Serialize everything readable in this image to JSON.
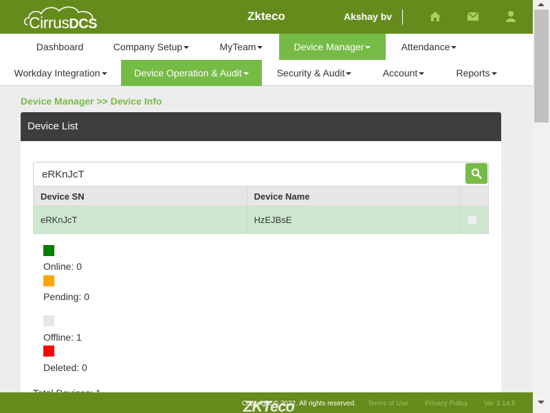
{
  "header": {
    "logo": {
      "prefix": "Cirrus",
      "suffix": "DCS"
    },
    "app_title": "Zkteco",
    "username": "Akshay bv",
    "icons": [
      "home-icon",
      "envelope-icon",
      "user-icon"
    ]
  },
  "nav": {
    "row1": [
      {
        "label": "Dashboard",
        "caret": false,
        "active": false
      },
      {
        "label": "Company Setup",
        "caret": true,
        "active": false
      },
      {
        "label": "MyTeam",
        "caret": true,
        "active": false
      },
      {
        "label": "Device Manager",
        "caret": true,
        "active": true
      },
      {
        "label": "Attendance",
        "caret": true,
        "active": false
      }
    ],
    "row2": [
      {
        "label": "Workday Integration",
        "caret": true,
        "active": false
      },
      {
        "label": "Device Operation & Audit",
        "caret": true,
        "active": true
      },
      {
        "label": "Security & Audit",
        "caret": true,
        "active": false
      },
      {
        "label": "Account",
        "caret": true,
        "active": false
      },
      {
        "label": "Reports",
        "caret": true,
        "active": false
      }
    ]
  },
  "breadcrumb": "Device Manager >> Device Info",
  "panel": {
    "title": "Device List",
    "search_value": "eRKnJcT",
    "table": {
      "columns": [
        "Device SN",
        "Device Name",
        ""
      ],
      "rows": [
        {
          "sn": "eRKnJcT",
          "name": "HzEJBsE",
          "checked": false
        }
      ]
    },
    "legend": [
      {
        "label": "Online: 0",
        "color": "#008000"
      },
      {
        "label": "Pending: 0",
        "color": "#ffa500"
      },
      {
        "label": "Offline: 1",
        "color": "#e6e6e6"
      },
      {
        "label": "Deleted: 0",
        "color": "#ff0000"
      }
    ],
    "total": "Total Devices: 1"
  },
  "footer": {
    "copyright": "Copyright © 2022. All rights reserved.",
    "watermark": "ZKTeco",
    "terms": "Terms of Use",
    "privacy": "Privacy Policy",
    "version": "Ver 3.14.8"
  },
  "colors": {
    "header_bg": "#668b1d",
    "accent": "#76bb46",
    "panel_head": "#3d3d3d",
    "selected_row": "#cde8cf"
  }
}
